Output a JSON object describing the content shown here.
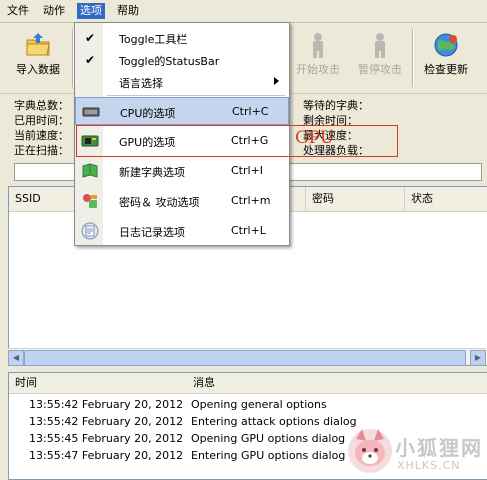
{
  "menubar": {
    "items": [
      {
        "label": "文件"
      },
      {
        "label": "动作"
      },
      {
        "label": "选项"
      },
      {
        "label": "帮助"
      }
    ]
  },
  "toolbar": {
    "import_label": "导入数据",
    "start_label": "开始攻击",
    "pause_label": "暂停攻击",
    "update_label": "检查更新"
  },
  "stats": {
    "dict_total": "字典总数：",
    "elapsed": "已用时间：",
    "current_speed": "当前速度：",
    "scanning": "正在扫描：",
    "waiting_dict": "等待的字典：",
    "remaining": "剩余时间：",
    "max_speed": "最大速度：",
    "processor_load": "处理器负载："
  },
  "results": {
    "columns": [
      "SSID",
      "密码",
      "状态"
    ]
  },
  "log": {
    "columns": [
      "时间",
      "消息"
    ],
    "rows": [
      {
        "time": "13:55:42 February 20, 2012",
        "message": "Opening general options"
      },
      {
        "time": "13:55:42 February 20, 2012",
        "message": "Entering attack options dialog"
      },
      {
        "time": "13:55:45 February 20, 2012",
        "message": "Opening GPU options dialog"
      },
      {
        "time": "13:55:47 February 20, 2012",
        "message": "Entering GPU options dialog"
      }
    ]
  },
  "menu": {
    "items": [
      {
        "label": "Toggle工具栏",
        "checked": true
      },
      {
        "label": "Toggle的StatusBar",
        "checked": true
      },
      {
        "label": "语言选择",
        "submenu": true
      },
      {
        "label": "CPU的选项",
        "shortcut": "Ctrl+C",
        "icon": "cpu-chip-icon"
      },
      {
        "label": "GPU的选项",
        "shortcut": "Ctrl+G",
        "icon": "gpu-card-icon"
      },
      {
        "label": "新建字典选项",
        "shortcut": "Ctrl+I",
        "icon": "book-icon"
      },
      {
        "label": "密码＆ 攻动选项",
        "shortcut": "Ctrl+m",
        "icon": "key-tools-icon"
      },
      {
        "label": "日志记录选项",
        "shortcut": "Ctrl+L",
        "icon": "log-file-icon"
      }
    ]
  },
  "annotation": {
    "text": "GPU",
    "color": "#d9381e"
  },
  "watermark": {
    "title": "小狐狸网",
    "url": "XHLKS.CN"
  },
  "colors": {
    "menu_highlight": "#316ac5",
    "window_bg": "#ece9d8"
  }
}
